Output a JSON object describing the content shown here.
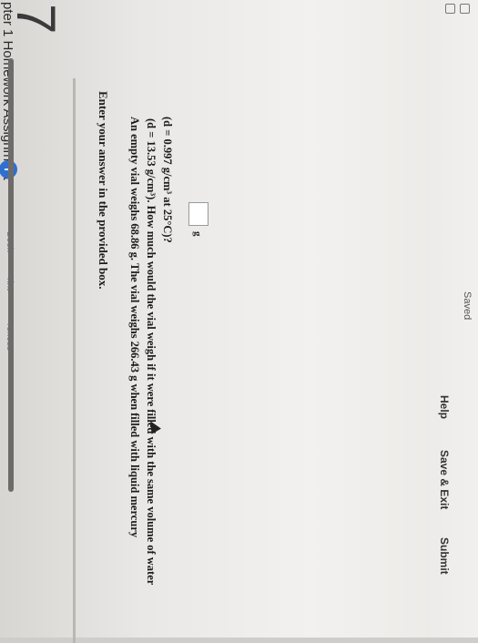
{
  "header": {
    "assignment_title": "pter 1 Homework Assignment",
    "info_badge": "i",
    "saved_status": "Saved",
    "help_label": "Help",
    "save_exit_label": "Save & Exit",
    "submit_label": "Submit"
  },
  "rail": {
    "items": [
      {
        "label": "Book"
      },
      {
        "label": "rint"
      },
      {
        "label": "rences"
      }
    ]
  },
  "question": {
    "number": "7",
    "instruction": "Enter your answer in the provided box.",
    "line1": "An empty vial weighs 68.86 g. The vial weighs 266.43 g when filled with liquid mercury",
    "line2": "(d = 13.53 g/cm³). How much would the vial weigh if it were filled with the same volume of water",
    "line3": "(d = 0.997 g/cm³ at 25°C)?",
    "answer_value": "",
    "answer_unit": "g"
  },
  "colors": {
    "accent": "#2f6fd0"
  }
}
